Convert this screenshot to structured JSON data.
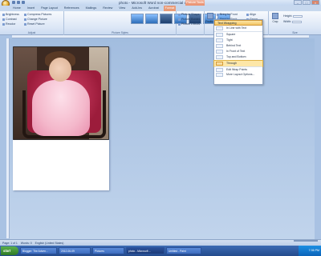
{
  "window": {
    "title": "photo - Microsoft Word non-commercial use",
    "context_tab_title": "Picture Tools",
    "minimize": "–",
    "maximize": "□",
    "close": "×"
  },
  "tabs": [
    "Home",
    "Insert",
    "Page Layout",
    "References",
    "Mailings",
    "Review",
    "View",
    "Add-Ins",
    "Acrobat",
    "Format"
  ],
  "ribbon": {
    "adjust": {
      "brightness": "Brightness",
      "contrast": "Contrast",
      "recolor": "Recolor",
      "compress": "Compress Pictures",
      "change": "Change Picture",
      "reset": "Reset Picture",
      "label": "Adjust"
    },
    "styles": {
      "shape": "Picture Shape",
      "border": "Picture Border",
      "effects": "Picture Effects",
      "label": "Picture Styles"
    },
    "arrange": {
      "position": "Position",
      "front": "Bring to Front",
      "back": "Send to Back",
      "wrap": "Text Wrapping",
      "align": "Align",
      "group": "Group",
      "rotate": "Rotate"
    },
    "size": {
      "crop": "Crop",
      "height": "Height:",
      "width": "Width:",
      "label": "Size"
    }
  },
  "wrap_menu": {
    "header": "Text Wrapping",
    "items": [
      {
        "label": "In Line with Text",
        "checked": false
      },
      {
        "label": "Square",
        "checked": false
      },
      {
        "label": "Tight",
        "checked": false
      },
      {
        "label": "Behind Text",
        "checked": false
      },
      {
        "label": "In Front of Text",
        "checked": false
      },
      {
        "label": "Top and Bottom",
        "checked": false
      },
      {
        "label": "Through",
        "checked": true
      },
      {
        "label": "Edit Wrap Points",
        "checked": false
      },
      {
        "label": "More Layout Options...",
        "checked": false
      }
    ]
  },
  "status": {
    "page": "Page: 1 of 1",
    "words": "Words: 0",
    "language": "English (United States)"
  },
  "taskbar": {
    "start": "start",
    "items": [
      "Blogger: The Adven...",
      "2012-06-09",
      "Pictures",
      "photo - Microsoft ...",
      "Untitled - Paint"
    ],
    "clock": "7:36 PM"
  }
}
